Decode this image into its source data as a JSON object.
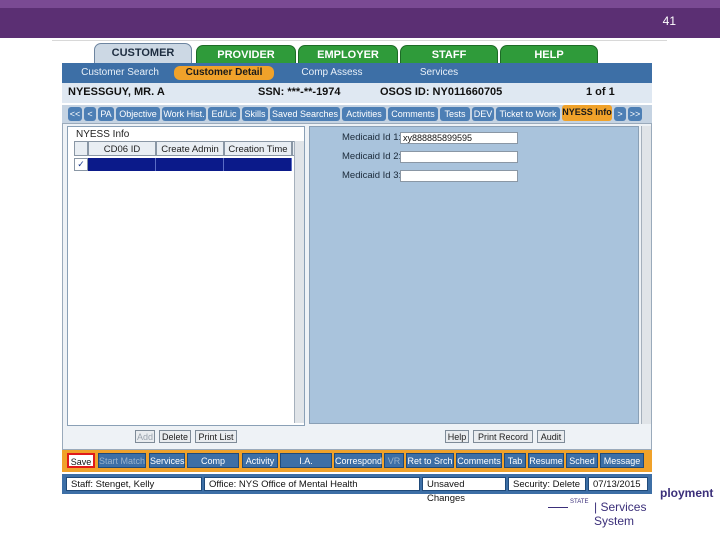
{
  "slide": {
    "number": "41"
  },
  "tabs": [
    {
      "label": "CUSTOMER",
      "active": true
    },
    {
      "label": "PROVIDER"
    },
    {
      "label": "EMPLOYER"
    },
    {
      "label": "STAFF"
    },
    {
      "label": "HELP"
    }
  ],
  "subnav": [
    {
      "label": "Customer Search"
    },
    {
      "label": "Customer Detail",
      "active": true
    },
    {
      "label": "Comp Assess"
    },
    {
      "label": "Services"
    }
  ],
  "customer": {
    "name": "NYESSGUY, MR. A",
    "ssn": "SSN: ***-**-1974",
    "osos_id": "OSOS ID: NY011660705",
    "record_count": "1 of 1"
  },
  "nav_buttons": [
    {
      "label": "<<"
    },
    {
      "label": "<"
    },
    {
      "label": "PA"
    },
    {
      "label": "Objective"
    },
    {
      "label": "Work Hist."
    },
    {
      "label": "Ed/Lic"
    },
    {
      "label": "Skills"
    },
    {
      "label": "Saved Searches"
    },
    {
      "label": "Activities"
    },
    {
      "label": "Comments"
    },
    {
      "label": "Tests"
    },
    {
      "label": "DEV"
    },
    {
      "label": "Ticket to Work"
    },
    {
      "label": "NYESS Info",
      "active": true
    },
    {
      "label": ">"
    },
    {
      "label": ">>"
    }
  ],
  "left_panel": {
    "title": "NYESS Info",
    "columns": [
      "CD06 ID",
      "Create Admin",
      "Creation Time",
      "-"
    ]
  },
  "medicaid": {
    "label1": "Medicaid Id 1:",
    "value1": "xy888885899595",
    "label2": "Medicaid Id 2:",
    "value2": "",
    "label3": "Medicaid Id 3:",
    "value3": ""
  },
  "left_buttons": {
    "add": "Add",
    "delete": "Delete",
    "print": "Print List"
  },
  "right_buttons": {
    "help": "Help",
    "print_record": "Print Record",
    "audit": "Audit"
  },
  "actions": [
    {
      "label": "Save"
    },
    {
      "label": "Start Match",
      "disabled": true
    },
    {
      "label": "Services"
    },
    {
      "label": "Comp Assess"
    },
    {
      "label": "Activity"
    },
    {
      "label": "I.A. Referrals"
    },
    {
      "label": "Correspond"
    },
    {
      "label": "VR",
      "disabled": true
    },
    {
      "label": "Ret to Srch"
    },
    {
      "label": "Comments"
    },
    {
      "label": "Tab"
    },
    {
      "label": "Resume"
    },
    {
      "label": "Sched"
    },
    {
      "label": "Message"
    }
  ],
  "status": {
    "staff": "Staff: Stenget, Kelly",
    "office": "Office: NYS Office of Mental Health",
    "changes": "Unsaved Changes",
    "security": "Security: Delete",
    "date": "07/13/2015"
  },
  "footer": {
    "ployment": "ployment",
    "state": "STATE",
    "system": "| Services System"
  }
}
